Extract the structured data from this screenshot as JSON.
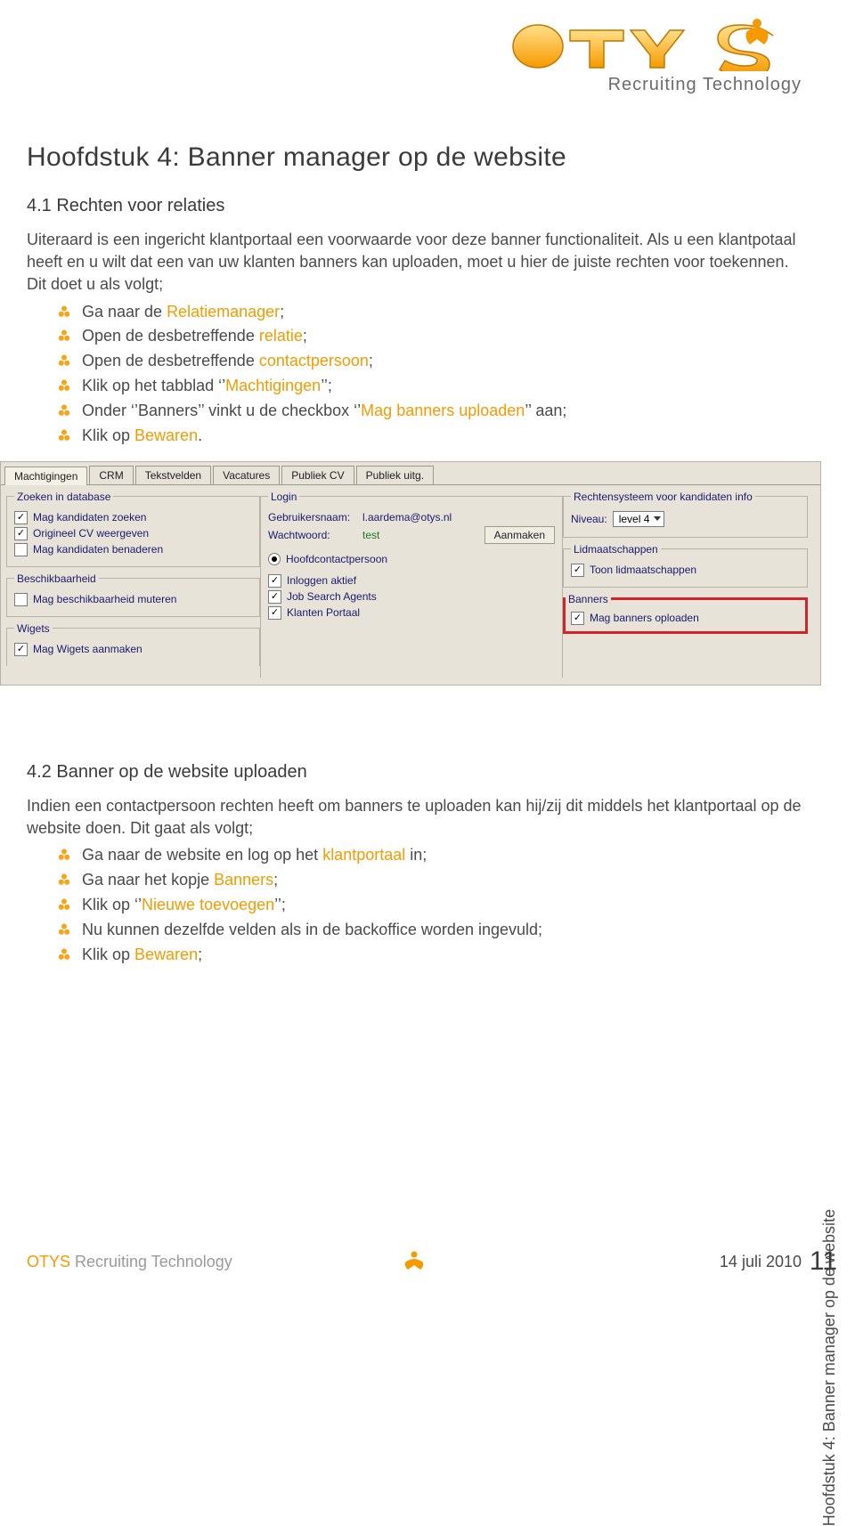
{
  "logo": {
    "tagline": "Recruiting Technology"
  },
  "h1": "Hoofdstuk 4: Banner manager op de website",
  "s41": {
    "title": "4.1 Rechten voor relaties",
    "p1": "Uiteraard is een ingericht klantportaal een voorwaarde voor deze banner functionaliteit. Als u een klantpotaal heeft en u wilt dat een van uw klanten banners kan uploaden, moet u hier de juiste rechten voor toekennen. Dit doet u als volgt;",
    "b1a": "Ga naar de ",
    "b1b": "Relatiemanager",
    "b1c": ";",
    "b2a": "Open de desbetreffende ",
    "b2b": "relatie",
    "b2c": ";",
    "b3a": "Open de desbetreffende ",
    "b3b": "contactpersoon",
    "b3c": ";",
    "b4a": "Klik op het tabblad ‘’",
    "b4b": "Machtigingen",
    "b4c": "’’;",
    "b5a": "Onder ‘’Banners’’ vinkt u de checkbox ‘’",
    "b5b": "Mag banners uploaden",
    "b5c": "’’ aan;",
    "b6a": "Klik op ",
    "b6b": "Bewaren",
    "b6c": "."
  },
  "shot": {
    "tabs": [
      "Machtigingen",
      "CRM",
      "Tekstvelden",
      "Vacatures",
      "Publiek CV",
      "Publiek uitg."
    ],
    "zoeken_legend": "Zoeken in database",
    "zoeken": [
      "Mag kandidaten zoeken",
      "Origineel CV weergeven",
      "Mag kandidaten benaderen"
    ],
    "besch_legend": "Beschikbaarheid",
    "besch": [
      "Mag beschikbaarheid muteren"
    ],
    "wigets_legend": "Wigets",
    "wigets": [
      "Mag Wigets aanmaken"
    ],
    "login_legend": "Login",
    "login_user_lbl": "Gebruikersnaam:",
    "login_user_val": "l.aardema@otys.nl",
    "login_pass_lbl": "Wachtwoord:",
    "login_pass_val": "test",
    "login_btn": "Aanmaken",
    "hoofdcontact": "Hoofdcontactpersoon",
    "inloggen": "Inloggen aktief",
    "jsa": "Job Search Agents",
    "klanten": "Klanten Portaal",
    "recht_legend": "Rechtensysteem voor kandidaten info",
    "niveau_lbl": "Niveau:",
    "niveau_val": "level 4",
    "lid_legend": "Lidmaatschappen",
    "lid": "Toon lidmaatschappen",
    "banners_legend": "Banners",
    "banners": "Mag banners oploaden"
  },
  "s42": {
    "title": "4.2 Banner op de website uploaden",
    "p1": "Indien een contactpersoon rechten heeft om banners te uploaden kan hij/zij dit middels het klantportaal op de website doen. Dit gaat als volgt;",
    "b1a": "Ga naar de website en log op het ",
    "b1b": "klantportaal",
    "b1c": " in;",
    "b2a": "Ga naar het kopje ",
    "b2b": "Banners",
    "b2c": ";",
    "b3a": "Klik op ‘’",
    "b3b": "Nieuwe toevoegen",
    "b3c": "’’;",
    "b4": "Nu kunnen dezelfde velden als in de backoffice worden ingevuld;",
    "b5a": "Klik op ",
    "b5b": "Bewaren",
    "b5c": ";"
  },
  "sidetext": "Hoofdstuk 4: Banner manager op de website",
  "footer": {
    "brand_o": "OTYS",
    "brand_rest": " Recruiting Technology",
    "date": "14 juli 2010",
    "page": "11"
  }
}
